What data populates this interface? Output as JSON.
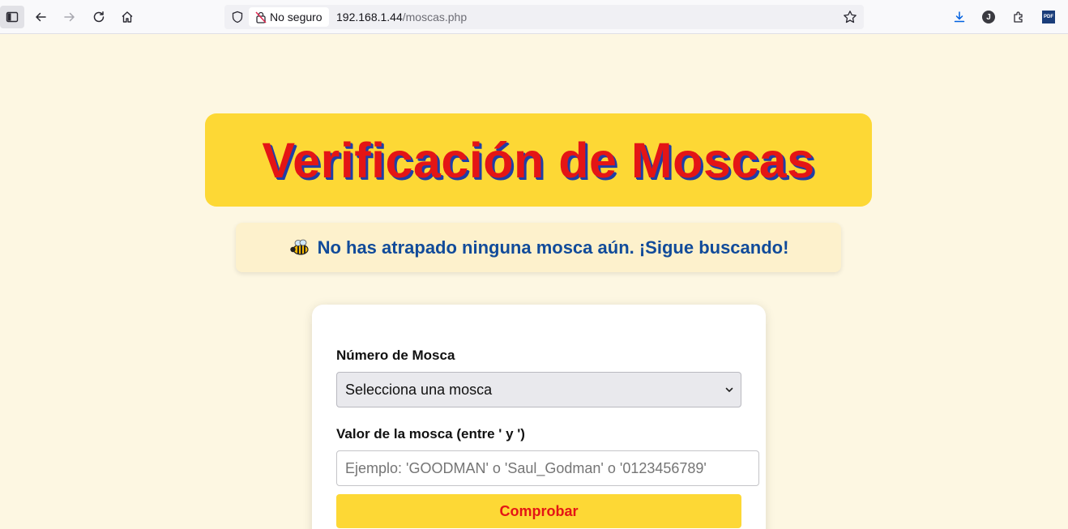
{
  "browser": {
    "security_label": "No seguro",
    "url_host": "192.168.1.44",
    "url_path": "/moscas.php",
    "account_initial": "J",
    "pdf_label": "PDF"
  },
  "page": {
    "title": "Verificación de Moscas",
    "status_message": "No has atrapado ninguna mosca aún. ¡Sigue buscando!",
    "form": {
      "number_label": "Número de Mosca",
      "number_selected": "Selecciona una mosca",
      "value_label": "Valor de la mosca (entre ' y ')",
      "value_placeholder": "Ejemplo: 'GOODMAN' o 'Saul_Godman' o '0123456789'",
      "value_current": "",
      "submit_label": "Comprobar"
    }
  },
  "colors": {
    "page_bg": "#fdf7e2",
    "banner_bg": "#fdd835",
    "title_red": "#e41515",
    "title_shadow_blue": "#1f3fa8",
    "status_text_blue": "#114b9a"
  }
}
